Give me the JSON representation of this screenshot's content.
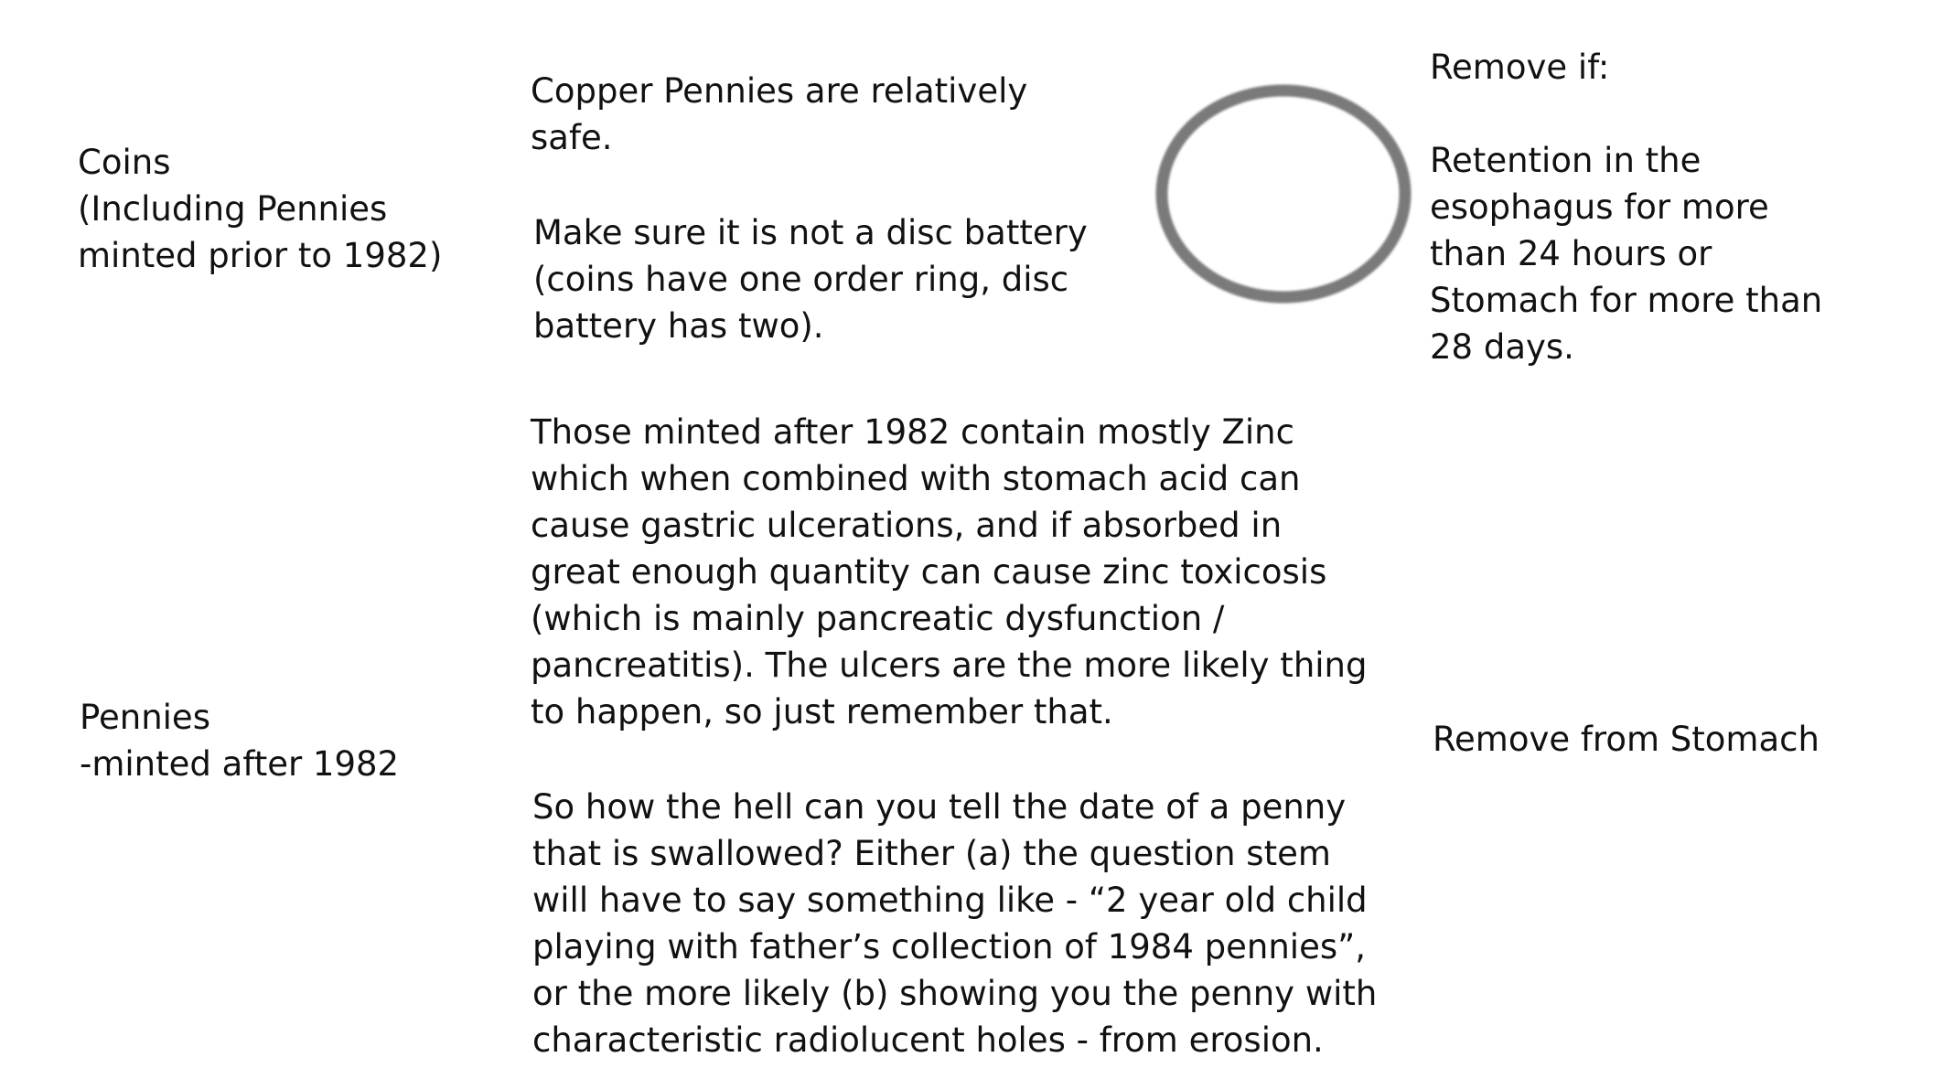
{
  "rows": [
    {
      "label": "Coins\n(Including Pennies\nminted prior to 1982)",
      "paragraphs": [
        "Copper Pennies are relatively\nsafe.",
        "Make sure it is not a disc battery\n(coins have one order ring, disc\nbattery has two)."
      ],
      "figure_icon": "coin-ring-icon",
      "removal": "Remove if:\n\nRetention in the\nesophagus for more\nthan 24 hours or\nStomach for more than\n28 days."
    },
    {
      "label": "Pennies\n-minted after 1982",
      "paragraphs": [
        "Those minted after 1982 contain mostly Zinc\nwhich when combined with stomach acid can\ncause gastric ulcerations, and if absorbed in\ngreat enough quantity can cause zinc toxicosis\n(which is mainly pancreatic dysfunction /\npancreatitis). The ulcers are the more likely thing\nto happen, so just remember that.",
        "So how the hell can you tell the date of a penny\nthat is swallowed? Either (a) the question stem\nwill have to say something like - “2 year old child\nplaying with father’s collection of 1984 pennies”,\nor the more likely (b) showing you the penny with\ncharacteristic radiolucent holes - from erosion."
      ],
      "removal": "Remove from Stomach"
    }
  ],
  "colors": {
    "text": "#111111",
    "ring": "#7a7a7a"
  }
}
